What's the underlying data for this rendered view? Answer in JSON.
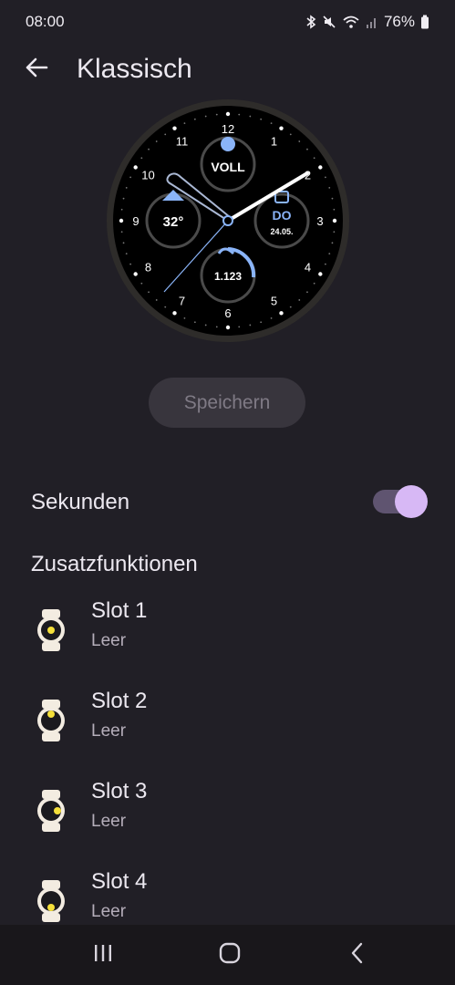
{
  "status_bar": {
    "time": "08:00",
    "battery": "76%",
    "icons": [
      "bluetooth-icon",
      "mute-icon",
      "wifi-icon",
      "signal-icon",
      "battery-icon"
    ]
  },
  "header": {
    "title": "Klassisch"
  },
  "watch_face": {
    "numerals": [
      "12",
      "1",
      "2",
      "3",
      "4",
      "5",
      "6",
      "7",
      "8",
      "9",
      "10",
      "11"
    ],
    "top_complication": "VOLL",
    "left_complication": "32°",
    "right_complication_day": "DO",
    "right_complication_date": "24.05.",
    "bottom_complication": "1.123",
    "accent_color": "#8ab4f8"
  },
  "save_button": {
    "label": "Speichern"
  },
  "settings": {
    "seconds_label": "Sekunden",
    "seconds_enabled": true,
    "complications_title": "Zusatzfunktionen",
    "slots": [
      {
        "name": "Slot 1",
        "value": "Leer"
      },
      {
        "name": "Slot 2",
        "value": "Leer"
      },
      {
        "name": "Slot 3",
        "value": "Leer"
      },
      {
        "name": "Slot 4",
        "value": "Leer"
      }
    ]
  },
  "colors": {
    "background": "#211f26",
    "toggle_thumb": "#d7b8f5",
    "toggle_track": "#5f5470",
    "slot_dot": "#f5e03a"
  },
  "nav_bar": {
    "icons": [
      "recents-icon",
      "home-icon",
      "back-nav-icon"
    ]
  }
}
